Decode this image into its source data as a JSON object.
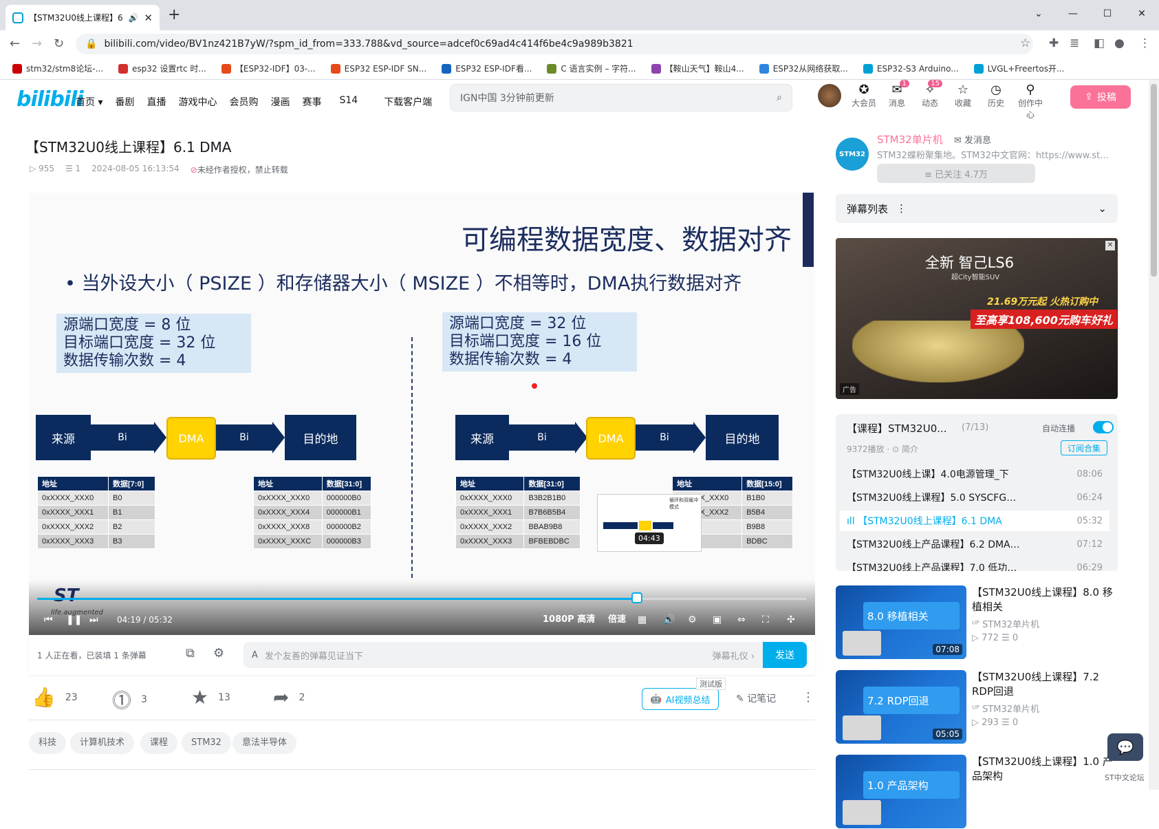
{
  "browser": {
    "tab_title": "【STM32U0线上课程】6",
    "url": "bilibili.com/video/BV1nz421B7yW/?spm_id_from=333.788&vd_source=adcef0c69ad4c414f6be4c9a989b3821",
    "bookmarks": [
      {
        "label": "stm32/stm8论坛-...",
        "color": "#c00"
      },
      {
        "label": "esp32 设置rtc 时...",
        "color": "#d32f2f"
      },
      {
        "label": "【ESP32-IDF】03-...",
        "color": "#e64a19"
      },
      {
        "label": "ESP32 ESP-IDF SN...",
        "color": "#e64a19"
      },
      {
        "label": "ESP32 ESP-IDF看...",
        "color": "#1565c0"
      },
      {
        "label": "C 语言实例 – 字符...",
        "color": "#6d8a2a"
      },
      {
        "label": "【鞍山天气】鞍山4...",
        "color": "#8e44ad"
      },
      {
        "label": "ESP32从网络获取...",
        "color": "#2e86de"
      },
      {
        "label": "ESP32-S3 Arduino...",
        "color": "#00a1d6"
      },
      {
        "label": "LVGL+Freertos开...",
        "color": "#00a1d6"
      }
    ]
  },
  "header": {
    "logo": "bilibili",
    "nav": [
      "首页 ▾",
      "番剧",
      "直播",
      "游戏中心",
      "会员购",
      "漫画",
      "赛事",
      "S14",
      "下载客户端"
    ],
    "search_placeholder": "IGN中国 3分钟前更新",
    "icons": [
      {
        "label": "大会员",
        "glyph": "✪",
        "badge": ""
      },
      {
        "label": "消息",
        "glyph": "✉",
        "badge": "1"
      },
      {
        "label": "动态",
        "glyph": "✧",
        "badge": "15"
      },
      {
        "label": "收藏",
        "glyph": "☆",
        "badge": ""
      },
      {
        "label": "历史",
        "glyph": "◷",
        "badge": ""
      },
      {
        "label": "创作中心",
        "glyph": "⚲",
        "badge": ""
      }
    ],
    "upload": "投稿"
  },
  "video": {
    "title": "【STM32U0线上课程】6.1 DMA",
    "views": "955",
    "danmaku_count": "1",
    "date": "2024-08-05 16:13:54",
    "notice": "未经作者授权，禁止转载"
  },
  "slide": {
    "title": "可编程数据宽度、数据对齐",
    "bullet": "• 当外设大小（ PSIZE ）和存储器大小（ MSIZE ）不相等时，DMA执行数据对齐",
    "left": {
      "info": [
        "源端口宽度 = 8 位",
        "目标端口宽度 = 32 位",
        "数据传输次数 = 4"
      ],
      "src": "来源",
      "arrow": "Bi",
      "dma": "DMA",
      "dst": "目的地",
      "src_table": {
        "headers": [
          "地址",
          "数据[7:0]"
        ],
        "rows": [
          [
            "0xXXXX_XXX0",
            "B0"
          ],
          [
            "0xXXXX_XXX1",
            "B1"
          ],
          [
            "0xXXXX_XXX2",
            "B2"
          ],
          [
            "0xXXXX_XXX3",
            "B3"
          ]
        ]
      },
      "dst_table": {
        "headers": [
          "地址",
          "数据[31:0]"
        ],
        "rows": [
          [
            "0xXXXX_XXX0",
            "000000B0"
          ],
          [
            "0xXXXX_XXX4",
            "000000B1"
          ],
          [
            "0xXXXX_XXX8",
            "000000B2"
          ],
          [
            "0xXXXX_XXXC",
            "000000B3"
          ]
        ]
      }
    },
    "right": {
      "info": [
        "源端口宽度 = 32 位",
        "目标端口宽度 = 16 位",
        "数据传输次数 = 4"
      ],
      "src": "来源",
      "arrow": "Bi",
      "dma": "DMA",
      "dst": "目的地",
      "src_table": {
        "headers": [
          "地址",
          "数据[31:0]"
        ],
        "rows": [
          [
            "0xXXXX_XXX0",
            "B3B2B1B0"
          ],
          [
            "0xXXXX_XXX1",
            "B7B6B5B4"
          ],
          [
            "0xXXXX_XXX2",
            "BBAB9B8"
          ],
          [
            "0xXXXX_XXX3",
            "BFBEBDBC"
          ]
        ]
      },
      "dst_table": {
        "headers": [
          "地址",
          "数据[15:0]"
        ],
        "rows": [
          [
            "0xXXXX_XXX0",
            "B1B0"
          ],
          [
            "0xXXXX_XXX2",
            "B5B4"
          ],
          [
            "",
            "B9B8"
          ],
          [
            "",
            "BDBC"
          ]
        ]
      }
    },
    "logo": "ST",
    "logo_sub": "life.augmented"
  },
  "player": {
    "hover_time": "04:43",
    "thumb_caption": "循环和双缓冲模式",
    "current": "04:19",
    "total": "05:32",
    "progress": 0.78,
    "quality": "1080P 高清",
    "speed": "倍速"
  },
  "danmaku_bar": {
    "status": "1 人正在看，已装填 1 条弹幕",
    "placeholder": "发个友善的弹幕见证当下",
    "etiquette": "弹幕礼仪 ›",
    "send": "发送"
  },
  "actions": {
    "like": "23",
    "coin": "3",
    "fav": "13",
    "share": "2",
    "ai_summary": "AI视频总结",
    "test_tag": "测试版",
    "notes": "记笔记"
  },
  "tags": [
    "科技",
    "计算机技术",
    "课程",
    "STM32",
    "意法半导体"
  ],
  "uploader": {
    "avatar_text": "STM32",
    "name": "STM32单片机",
    "message": "发消息",
    "desc": "STM32蝶粉聚集地。STM32中文官网：https://www.st...",
    "follow": "≡ 已关注 4.7万"
  },
  "danmaku_list": {
    "title": "弹幕列表"
  },
  "ad": {
    "title": "全新 智己LS6",
    "subtitle": "超City智能SUV",
    "price": "21.69万元起 火热订购中",
    "promo": "至高享108,600元购车好礼",
    "tag": "广告"
  },
  "playlist": {
    "title": "【课程】STM32U0...",
    "count": "(7/13)",
    "autoplay": "自动连播",
    "views": "9372播放 · ⊙ 简介",
    "subscribe": "订阅合集",
    "items": [
      {
        "title": "【STM32U0线上课】4.0电源管理_下",
        "dur": "08:06"
      },
      {
        "title": "【STM32U0线上课程】5.0 SYSCFG…",
        "dur": "06:24"
      },
      {
        "title": "ıll 【STM32U0线上课程】6.1 DMA",
        "dur": "05:32"
      },
      {
        "title": "【STM32U0线上产品课程】6.2 DMA…",
        "dur": "07:12"
      },
      {
        "title": "【STM32U0线上产品课程】7.0 低功…",
        "dur": "06:29"
      }
    ]
  },
  "recommended": [
    {
      "thumb": "8.0 移植相关",
      "dur": "07:08",
      "title": "【STM32U0线上课程】8.0 移植相关",
      "owner": "STM32单片机",
      "views": "772",
      "dm": "0"
    },
    {
      "thumb": "7.2 RDP回退",
      "dur": "05:05",
      "title": "【STM32U0线上课程】7.2 RDP回退",
      "owner": "STM32单片机",
      "views": "293",
      "dm": "0"
    },
    {
      "thumb": "1.0 产品架构",
      "dur": "",
      "title": "【STM32U0线上课程】1.0 产品架构",
      "owner": "",
      "views": "",
      "dm": ""
    }
  ],
  "float": {
    "label": "ST中文论坛"
  }
}
